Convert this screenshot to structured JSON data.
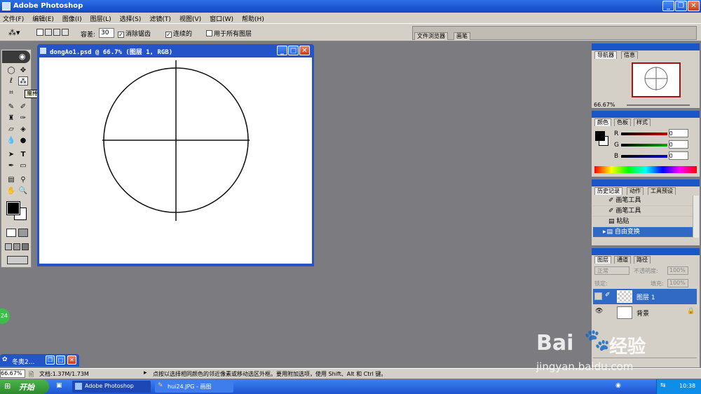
{
  "app": {
    "title": "Adobe Photoshop"
  },
  "menu": [
    "文件(F)",
    "编辑(E)",
    "图像(I)",
    "图层(L)",
    "选择(S)",
    "滤镜(T)",
    "视图(V)",
    "窗口(W)",
    "帮助(H)"
  ],
  "options": {
    "tolerance_label": "容差:",
    "tolerance_value": "30",
    "antialias": "消除锯齿",
    "contiguous": "连续的",
    "all_layers": "用于所有图层"
  },
  "well": {
    "file_browser": "文件浏览器",
    "brushes": "画笔"
  },
  "document": {
    "title": "dongAo1.psd @ 66.7% (图层 1, RGB)"
  },
  "tooltip": "魔棒工具 (W)",
  "navigator": {
    "tabs": [
      "导航器",
      "信息"
    ],
    "zoom": "66.67%"
  },
  "color": {
    "tabs": [
      "颜色",
      "色板",
      "样式"
    ],
    "r_label": "R",
    "g_label": "G",
    "b_label": "B",
    "r": "0",
    "g": "0",
    "b": "0"
  },
  "history": {
    "tabs": [
      "历史记录",
      "动作",
      "工具预设"
    ],
    "items": [
      "画笔工具",
      "画笔工具",
      "粘贴",
      "自由变换"
    ]
  },
  "layers": {
    "tabs": [
      "图层",
      "通道",
      "路径"
    ],
    "blend": "正常",
    "opacity_label": "不透明度:",
    "opacity": "100%",
    "lock_label": "锁定:",
    "fill_label": "填充:",
    "fill": "100%",
    "items": [
      "图层 1",
      "背景"
    ]
  },
  "status": {
    "zoom": "66.67%",
    "doc": "文档:1.37M/1.73M",
    "hint": "点按以选择相同颜色的邻近像素或移动选区外框。要用附加选项，使用 Shift、Alt 和 Ctrl 键。"
  },
  "minimized": {
    "title": "冬奥2..."
  },
  "badge": "24",
  "taskbar": {
    "start": "开始",
    "items": [
      "Adobe Photoshop",
      "hui24.JPG - 画图"
    ],
    "clock": "10:38"
  },
  "watermark": {
    "brand": "Bai",
    "brand2": "经验",
    "url": "jingyan.baidu.com"
  }
}
